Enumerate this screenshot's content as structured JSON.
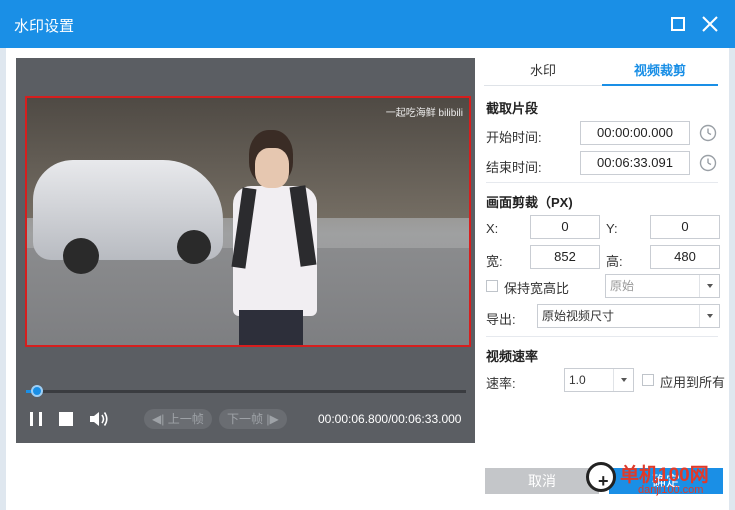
{
  "window": {
    "title": "水印设置"
  },
  "player": {
    "watermark_text": "一起吃海鲜 bilibili",
    "progress_fraction": 0.018,
    "prev_frame_label": "上一帧",
    "next_frame_label": "下一帧",
    "time_readout": "00:00:06.800/00:06:33.000"
  },
  "tabs": [
    {
      "label": "水印",
      "active": false
    },
    {
      "label": "视频裁剪",
      "active": true
    }
  ],
  "clip": {
    "section_title": "截取片段",
    "start_label": "开始时间:",
    "start_value": "00:00:00.000",
    "end_label": "结束时间:",
    "end_value": "00:06:33.091"
  },
  "crop": {
    "section_title": "画面剪裁（PX)",
    "x_label": "X:",
    "x_value": "0",
    "y_label": "Y:",
    "y_value": "0",
    "width_label": "宽:",
    "width_value": "852",
    "height_label": "高:",
    "height_value": "480",
    "keep_ratio_label": "保持宽高比",
    "keep_ratio_checked": false,
    "ratio_select_value": "原始",
    "export_label": "导出:",
    "export_select_value": "原始视频尺寸"
  },
  "speed": {
    "section_title": "视频速率",
    "rate_label": "速率:",
    "rate_value": "1.0",
    "apply_all_label": "应用到所有",
    "apply_all_checked": false
  },
  "footer": {
    "cancel_label": "取消",
    "ok_label": "确定"
  },
  "site": {
    "name": "单机100网",
    "url": "danji100.com"
  },
  "colors": {
    "accent": "#1a8fe6",
    "crop_border": "#d61e1e",
    "player_bg": "#5b5e63"
  }
}
